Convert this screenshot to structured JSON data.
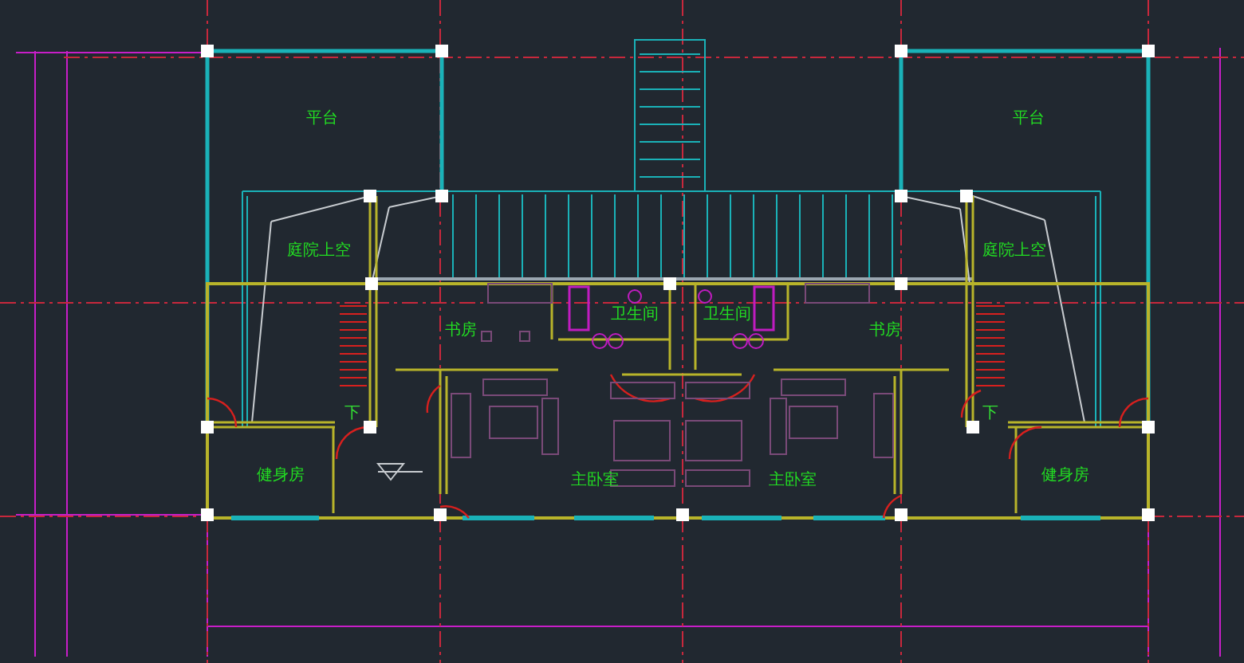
{
  "floor_plan": {
    "labels": [
      {
        "text": "平台",
        "kind": "room"
      },
      {
        "text": "平台",
        "kind": "room"
      },
      {
        "text": "庭院上空",
        "kind": "room"
      },
      {
        "text": "庭院上空",
        "kind": "room"
      },
      {
        "text": "书房",
        "kind": "room"
      },
      {
        "text": "卫生间",
        "kind": "room"
      },
      {
        "text": "卫生间",
        "kind": "room"
      },
      {
        "text": "书房",
        "kind": "room"
      },
      {
        "text": "下",
        "kind": "stair"
      },
      {
        "text": "下",
        "kind": "stair"
      },
      {
        "text": "健身房",
        "kind": "room"
      },
      {
        "text": "主卧室",
        "kind": "room"
      },
      {
        "text": "主卧室",
        "kind": "room"
      },
      {
        "text": "健身房",
        "kind": "room"
      }
    ]
  }
}
